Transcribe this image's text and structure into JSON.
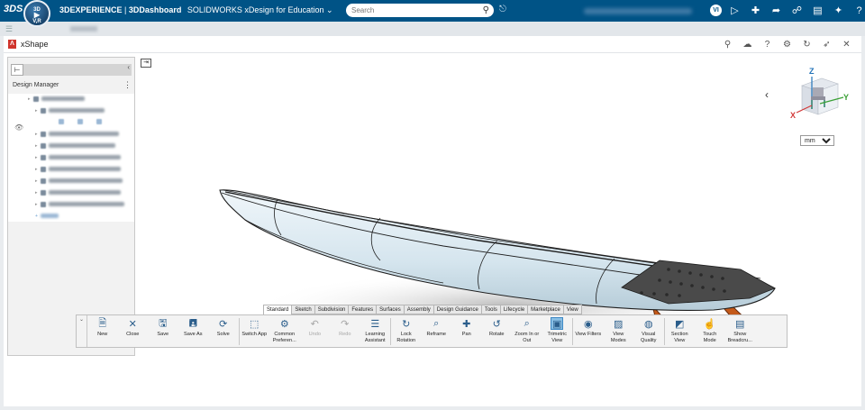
{
  "topbar": {
    "logo": "3DS",
    "compass": {
      "top": "3D",
      "bottom": "V,R"
    },
    "brand": "3DEXPERIENCE",
    "dashboard": "3DDashboard",
    "app": "SOLIDWORKS xDesign for Education",
    "search_placeholder": "Search",
    "user_initials": "VI"
  },
  "widget": {
    "title": "xShape"
  },
  "design_manager": {
    "label": "Design Manager"
  },
  "viewport": {
    "unit_options": [
      "mm"
    ],
    "unit_value": "mm",
    "axes": {
      "x": "X",
      "y": "Y",
      "z": "Z"
    }
  },
  "tabs": [
    "Standard",
    "Sketch",
    "Subdivision",
    "Features",
    "Surfaces",
    "Assembly",
    "Design Guidance",
    "Tools",
    "Lifecycle",
    "Marketplace",
    "View"
  ],
  "active_tab": "Standard",
  "ribbon": [
    {
      "label": "New",
      "icon": "new-icon",
      "state": "normal"
    },
    {
      "label": "Close",
      "icon": "close-doc-icon",
      "state": "normal"
    },
    {
      "label": "Save",
      "icon": "save-icon",
      "state": "normal"
    },
    {
      "label": "Save As",
      "icon": "save-as-icon",
      "state": "normal"
    },
    {
      "label": "Solve",
      "icon": "solve-icon",
      "state": "normal"
    },
    {
      "sep": true
    },
    {
      "label": "Switch App",
      "icon": "switch-app-icon",
      "state": "normal"
    },
    {
      "label": "Common\nPreferen...",
      "icon": "preferences-icon",
      "state": "normal"
    },
    {
      "label": "Undo",
      "icon": "undo-icon",
      "state": "disabled"
    },
    {
      "label": "Redo",
      "icon": "redo-icon",
      "state": "disabled"
    },
    {
      "label": "Learning\nAssistant",
      "icon": "learning-icon",
      "state": "normal"
    },
    {
      "sep": true
    },
    {
      "label": "Lock\nRotation",
      "icon": "lock-rotation-icon",
      "state": "normal"
    },
    {
      "label": "Reframe",
      "icon": "reframe-icon",
      "state": "normal"
    },
    {
      "label": "Pan",
      "icon": "pan-icon",
      "state": "normal"
    },
    {
      "label": "Rotate",
      "icon": "rotate-icon",
      "state": "normal"
    },
    {
      "label": "Zoom In or\nOut",
      "icon": "zoom-icon",
      "state": "normal"
    },
    {
      "label": "Trimetric\nView",
      "icon": "trimetric-icon",
      "state": "active"
    },
    {
      "sep": true
    },
    {
      "label": "View Filters",
      "icon": "view-filters-icon",
      "state": "normal"
    },
    {
      "label": "View\nModes",
      "icon": "view-modes-icon",
      "state": "normal"
    },
    {
      "label": "Visual\nQuality",
      "icon": "visual-quality-icon",
      "state": "normal"
    },
    {
      "sep": true
    },
    {
      "label": "Section\nView",
      "icon": "section-view-icon",
      "state": "normal"
    },
    {
      "label": "Touch\nMode",
      "icon": "touch-mode-icon",
      "state": "normal"
    },
    {
      "label": "Show\nBreadcru...",
      "icon": "breadcrumb-icon",
      "state": "normal"
    }
  ],
  "colors": {
    "topbar": "#005386",
    "board": "#d7e6ee",
    "fin": "#c45a1a",
    "tailpad": "#4a4a4a"
  }
}
